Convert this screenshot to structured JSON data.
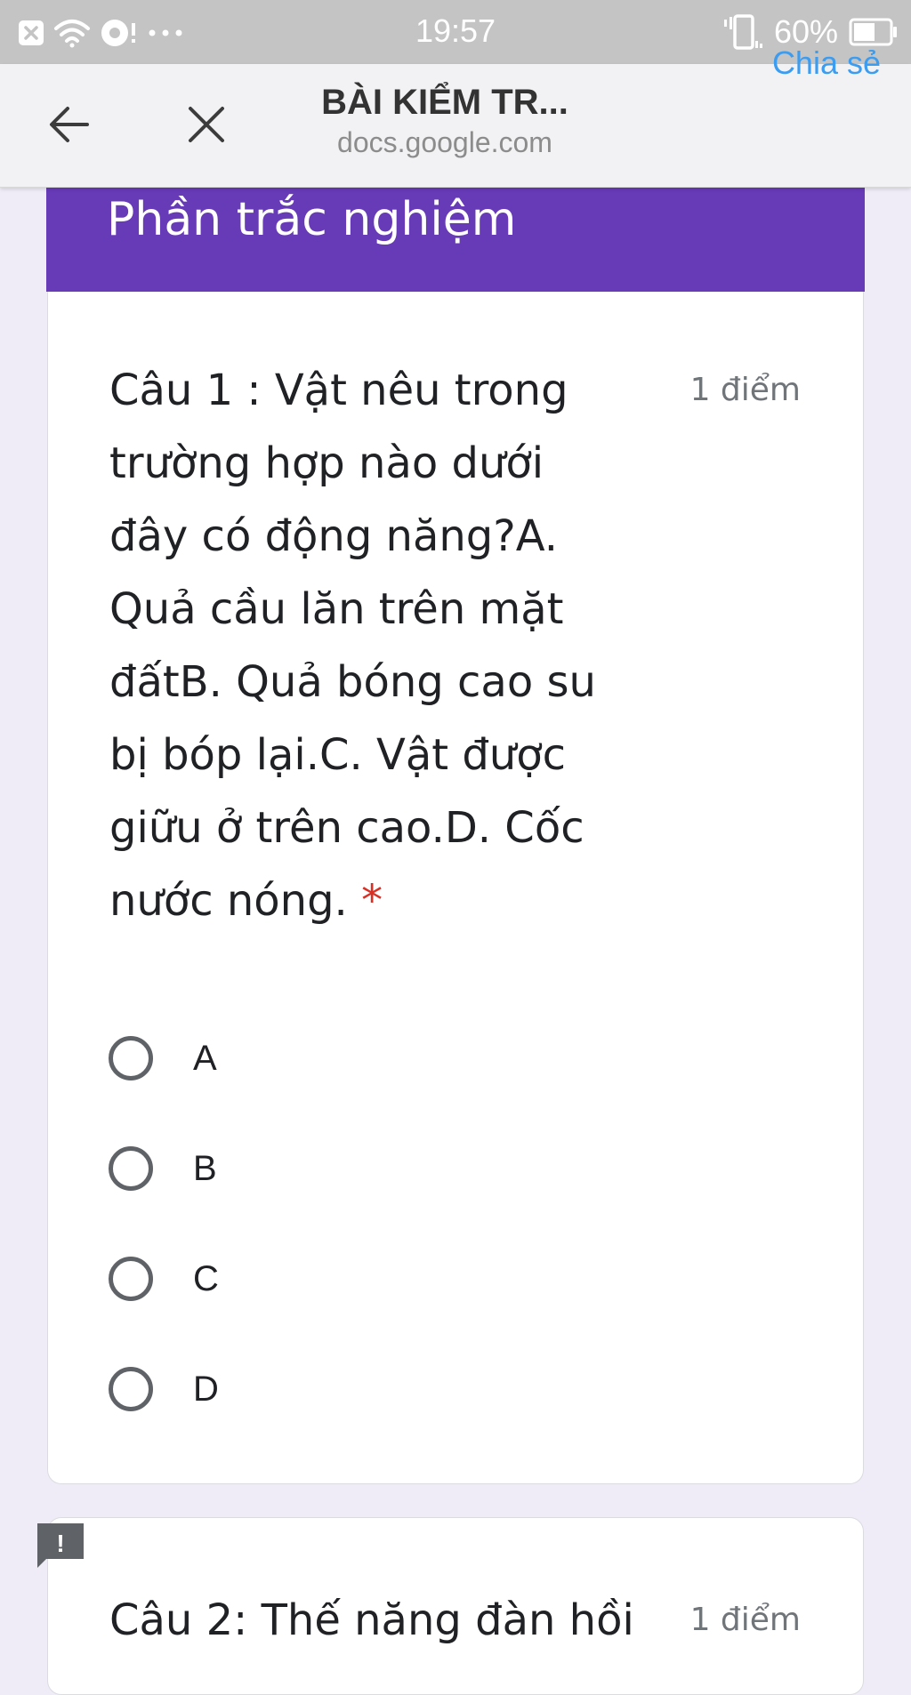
{
  "status_bar": {
    "time": "19:57",
    "battery": "60%",
    "colors": {
      "background": "#c4c4c4",
      "foreground": "#ffffff"
    },
    "icons": [
      "notification-x-icon",
      "wifi-icon",
      "sync-alert-icon",
      "more-dots-icon",
      "vibrate-icon",
      "signal-icon",
      "battery-icon"
    ]
  },
  "toolbar": {
    "title": "BÀI KIỂM TR...",
    "domain": "docs.google.com",
    "share_label": "Chia sẻ",
    "icons": {
      "back": "arrow-left-icon",
      "close": "close-icon"
    },
    "colors": {
      "share": "#3b9cf0"
    }
  },
  "form": {
    "section_title": "Phần trắc nghiệm",
    "colors": {
      "header": "#673ab7",
      "background": "#efebf7",
      "required": "#d93025"
    },
    "questions": [
      {
        "text": "Câu 1 : Vật nêu trong trường hợp nào dưới đây có động năng?A. Quả cầu lăn trên mặt đấtB. Quả bóng cao su bị bóp lại.C. Vật được giữu ở trên cao.D. Cốc nước nóng.",
        "required_mark": "*",
        "points": "1 điểm",
        "options": [
          "A",
          "B",
          "C",
          "D"
        ]
      },
      {
        "text": "Câu 2: Thế năng đàn hồi",
        "points": "1 điểm"
      }
    ]
  },
  "feedback": {
    "icon": "report-issue-icon",
    "glyph": "!"
  }
}
